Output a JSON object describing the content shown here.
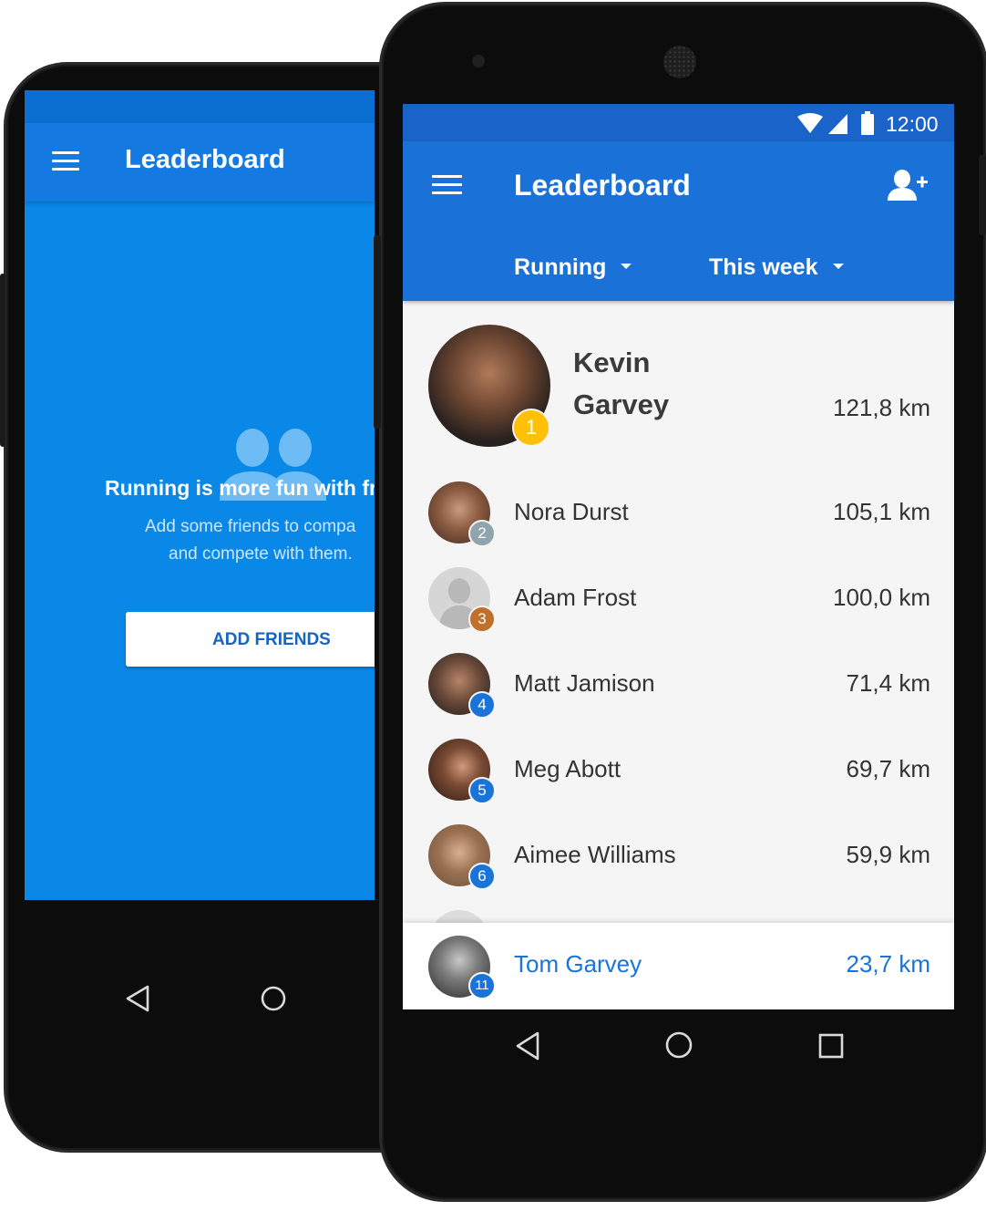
{
  "back_phone": {
    "appbar": {
      "title": "Leaderboard"
    },
    "empty_state": {
      "icon": "people-icon",
      "title": "Running is more fun with fr",
      "line1": "Add some friends to compa",
      "line2": "and compete with them.",
      "button_label": "ADD FRIENDS"
    }
  },
  "front_phone": {
    "status_bar": {
      "time": "12:00"
    },
    "appbar": {
      "title": "Leaderboard",
      "activity_filter": "Running",
      "period_filter": "This week"
    },
    "leader": {
      "name_line1": "Kevin",
      "name_line2": "Garvey",
      "distance": "121,8 km",
      "rank": "1"
    },
    "entries": [
      {
        "rank": "2",
        "name": "Nora Durst",
        "distance": "105,1 km"
      },
      {
        "rank": "3",
        "name": "Adam Frost",
        "distance": "100,0 km"
      },
      {
        "rank": "4",
        "name": "Matt Jamison",
        "distance": "71,4 km"
      },
      {
        "rank": "5",
        "name": "Meg Abott",
        "distance": "69,7 km"
      },
      {
        "rank": "6",
        "name": "Aimee Williams",
        "distance": "59,9 km"
      }
    ],
    "current_user": {
      "rank": "11",
      "name": "Tom Garvey",
      "distance": "23,7 km"
    }
  },
  "colors": {
    "primary": "#1a71d8",
    "primary_dark": "#1a63c8",
    "back_screen": "#0a88e8",
    "gold": "#ffc107",
    "silver": "#90a4ae",
    "bronze": "#c0702c",
    "highlight_text": "#1a73d8"
  }
}
